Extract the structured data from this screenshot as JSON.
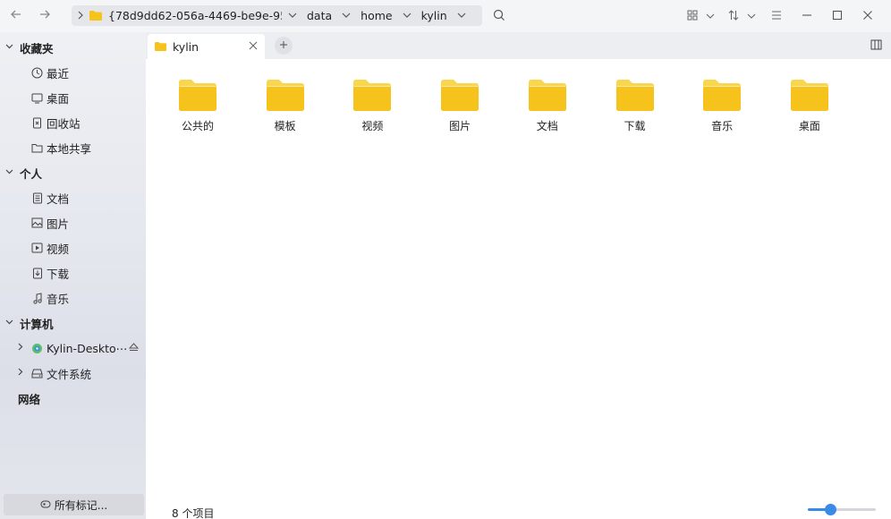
{
  "toolbar": {
    "back_icon": "arrow-left-icon",
    "forward_icon": "arrow-right-icon",
    "breadcrumbs": [
      {
        "label": "{78d9dd62-056a-4469-be9e-953⋯"
      },
      {
        "label": "data"
      },
      {
        "label": "home"
      },
      {
        "label": "kylin"
      }
    ]
  },
  "sidebar": {
    "groups": [
      {
        "label": "收藏夹",
        "items": [
          {
            "label": "最近",
            "icon": "clock-icon"
          },
          {
            "label": "桌面",
            "icon": "monitor-icon"
          },
          {
            "label": "回收站",
            "icon": "trash-icon"
          },
          {
            "label": "本地共享",
            "icon": "folder-icon"
          }
        ]
      },
      {
        "label": "个人",
        "items": [
          {
            "label": "文档",
            "icon": "document-icon"
          },
          {
            "label": "图片",
            "icon": "image-icon"
          },
          {
            "label": "视频",
            "icon": "video-icon"
          },
          {
            "label": "下载",
            "icon": "download-icon"
          },
          {
            "label": "音乐",
            "icon": "music-icon"
          }
        ]
      },
      {
        "label": "计算机",
        "items": [
          {
            "label": "Kylin-Deskto⋯",
            "icon": "disc-icon"
          },
          {
            "label": "文件系统",
            "icon": "drive-icon"
          }
        ]
      },
      {
        "label": "网络"
      }
    ],
    "footer_label": "所有标记..."
  },
  "tabs": [
    {
      "label": "kylin"
    }
  ],
  "files": [
    {
      "name": "公共的"
    },
    {
      "name": "模板"
    },
    {
      "name": "视频"
    },
    {
      "name": "图片"
    },
    {
      "name": "文档"
    },
    {
      "name": "下载"
    },
    {
      "name": "音乐"
    },
    {
      "name": "桌面"
    }
  ],
  "status": {
    "item_count": "8 个项目",
    "zoom_level": 0.3
  },
  "colors": {
    "folder_body": "#f6c21c",
    "folder_tab": "#f9d64f",
    "accent": "#3a8ae8"
  }
}
